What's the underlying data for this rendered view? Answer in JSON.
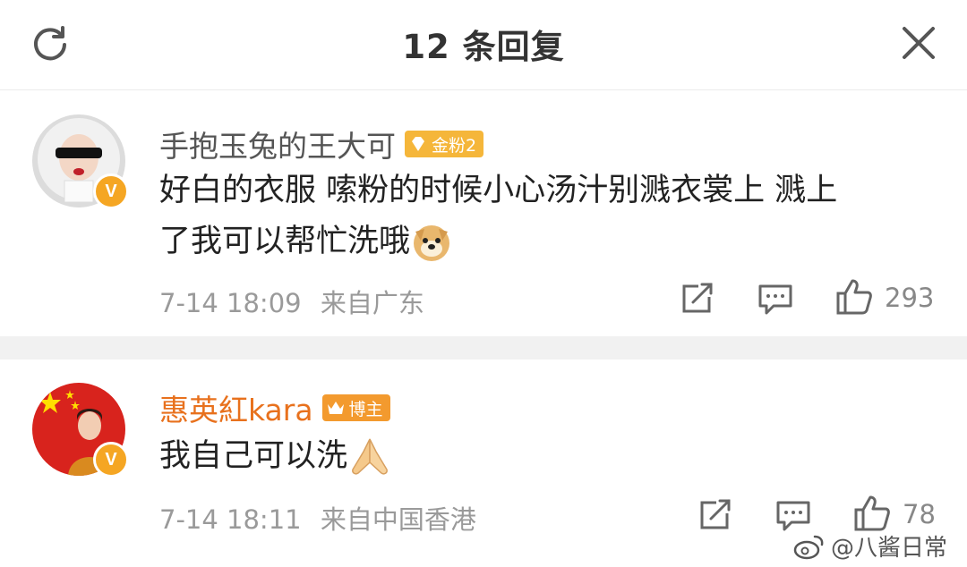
{
  "header": {
    "title": "12 条回复",
    "refresh_icon": "refresh-icon",
    "close_icon": "close-icon"
  },
  "comments": [
    {
      "username": "手抱玉兔的王大可",
      "badge": "金粉2",
      "verified": "V",
      "text_line1": "好白的衣服 嗦粉的时候小心汤汁别溅衣裳上 溅上",
      "text_line2": "了我可以帮忙洗哦",
      "emoji": "doge-emoji",
      "time": "7-14 18:09",
      "location": "来自广东",
      "likes": "293"
    },
    {
      "username": "惠英紅kara",
      "badge": "博主",
      "verified": "V",
      "text": "我自己可以洗",
      "emoji": "pray-hands-emoji",
      "time": "7-14 18:11",
      "location": "来自中国香港",
      "likes": "78"
    }
  ],
  "watermark": {
    "handle": "@八酱日常",
    "icon": "weibo-logo-icon"
  },
  "colors": {
    "accent_orange": "#e8711d",
    "badge_gold": "#f5b63a",
    "meta_gray": "#9a9a9a",
    "separator": "#f1f1f1"
  }
}
